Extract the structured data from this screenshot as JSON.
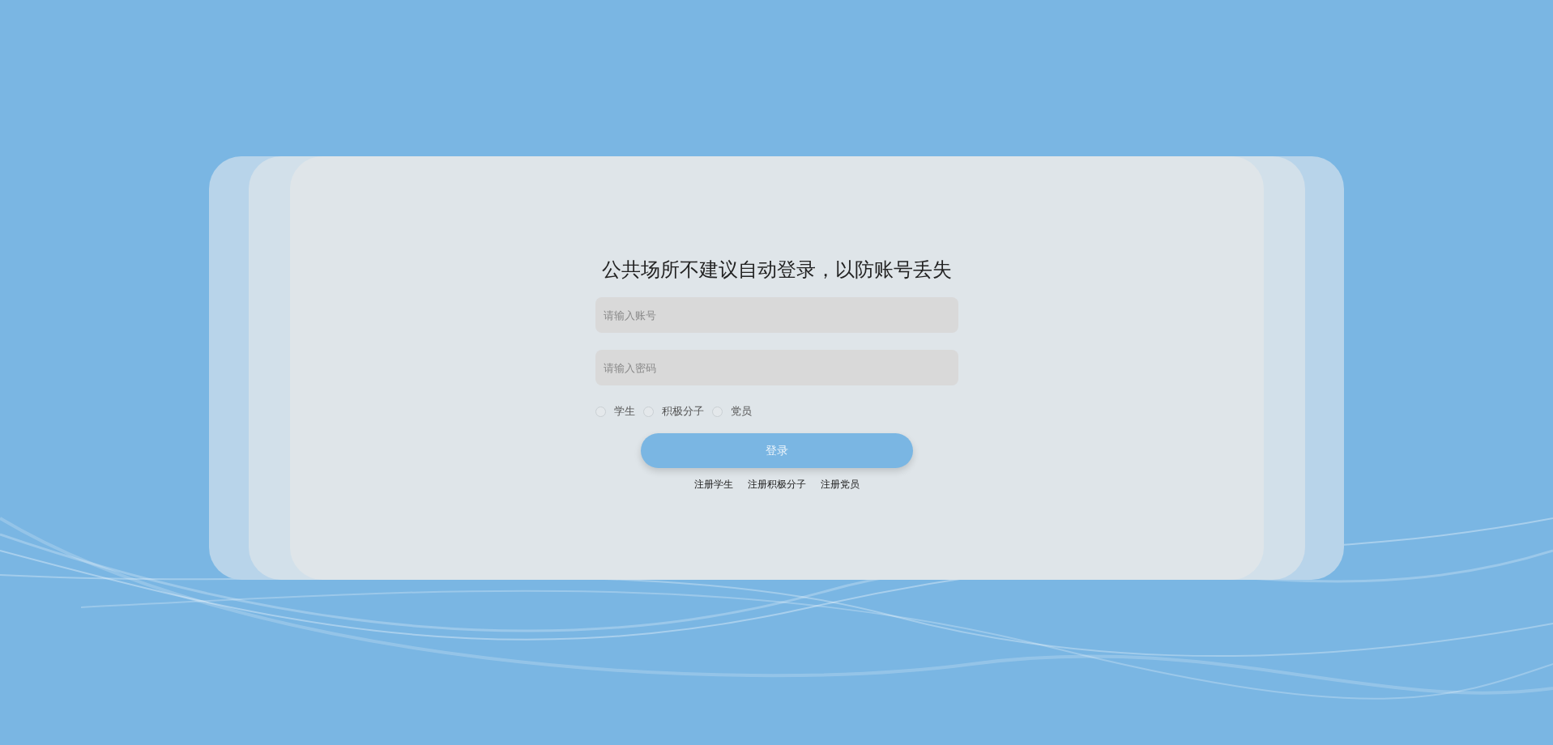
{
  "title": "公共场所不建议自动登录，以防账号丢失",
  "fields": [
    {
      "placeholder": "请输入账号"
    },
    {
      "placeholder": "请输入密码"
    }
  ],
  "roles": [
    {
      "label": "学生",
      "selected": false
    },
    {
      "label": "积极分子",
      "selected": false
    },
    {
      "label": "党员",
      "selected": false
    }
  ],
  "login_button": "登录",
  "links": [
    "注册学生",
    "注册积极分子",
    "注册党员"
  ]
}
